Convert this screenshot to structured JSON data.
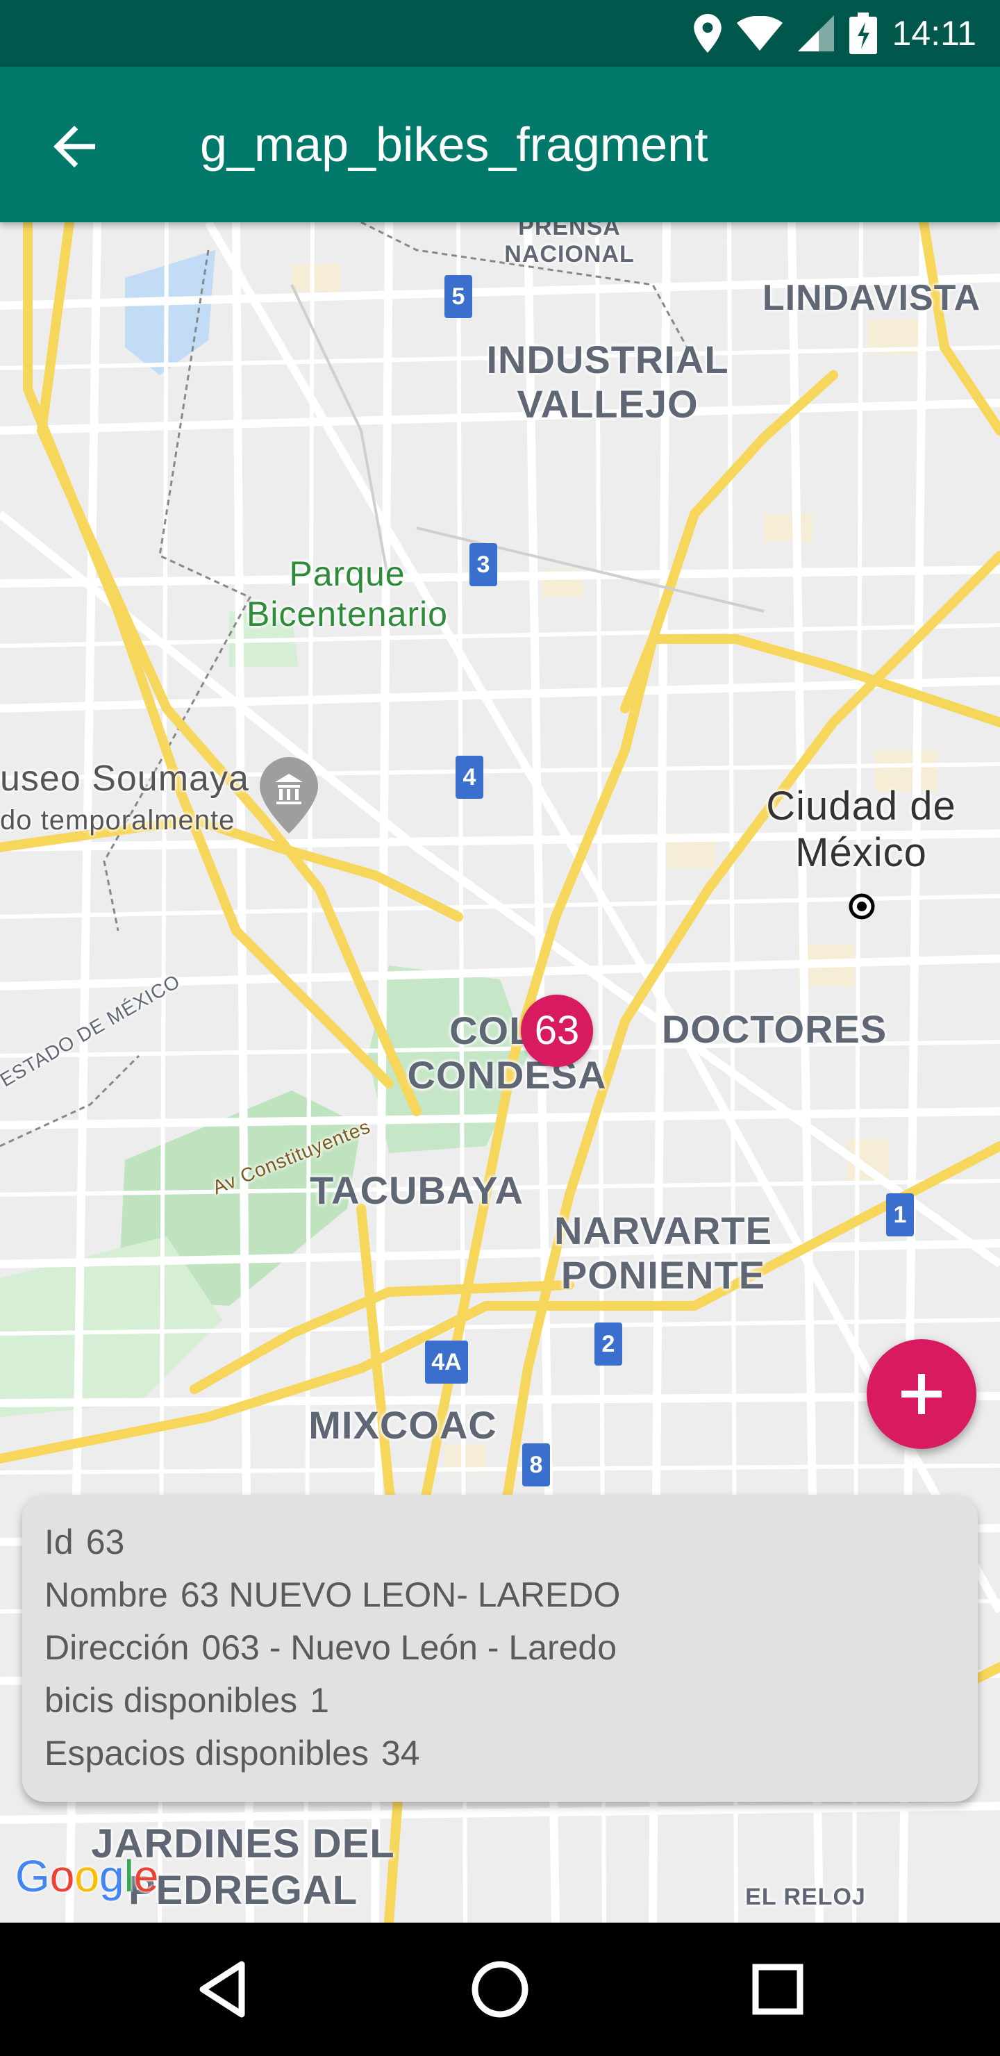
{
  "status_bar": {
    "time": "14:11",
    "icons": [
      "location-icon",
      "wifi-icon",
      "signal-icon",
      "battery-charging-icon"
    ]
  },
  "app_bar": {
    "title": "g_map_bikes_fragment",
    "back_icon": "arrow-back-icon"
  },
  "map": {
    "labels": {
      "prensa_nacional": "PRENSA\nNACIONAL",
      "lindavista": "LINDAVISTA",
      "industrial_vallejo": "INDUSTRIAL\nVALLEJO",
      "parque_bicentenario": "Parque\nBicentenario",
      "museo_soumaya": "useo Soumaya",
      "museo_soumaya_sub": "do temporalmente",
      "ciudad_de_mexico": "Ciudad de\nMéxico",
      "estado_de_mexico": "ESTADO DE MÉXICO",
      "colonia_condesa": "COLO\nCONDESA",
      "doctores": "DOCTORES",
      "av_constituyentes": "Av Constituyentes",
      "tacubaya": "TACUBAYA",
      "narvarte_poniente": "NARVARTE\nPONIENTE",
      "mixcoac": "MIXCOAC",
      "jardines_del_pedregal": "JARDINES DEL\nPEDREGAL",
      "el_reloj": "EL RELOJ"
    },
    "metro_badges": [
      "5",
      "3",
      "4",
      "1",
      "2",
      "4A",
      "8"
    ],
    "cluster_marker": "63",
    "google_logo": "Google"
  },
  "fab": {
    "icon": "plus-icon"
  },
  "info_card": {
    "rows": [
      {
        "label": "Id",
        "value": "63"
      },
      {
        "label": "Nombre",
        "value": "63 NUEVO LEON- LAREDO"
      },
      {
        "label": "Dirección",
        "value": "063 - Nuevo León - Laredo"
      },
      {
        "label": "bicis disponibles",
        "value": "1"
      },
      {
        "label": "Espacios disponibles",
        "value": "34"
      }
    ]
  },
  "nav_bar": {
    "icons": [
      "back-triangle-icon",
      "home-circle-icon",
      "recents-square-icon"
    ]
  },
  "colors": {
    "app_bar": "#00796b",
    "status_bar": "#00574b",
    "accent": "#d81b60",
    "card": "#e1e1e1"
  }
}
